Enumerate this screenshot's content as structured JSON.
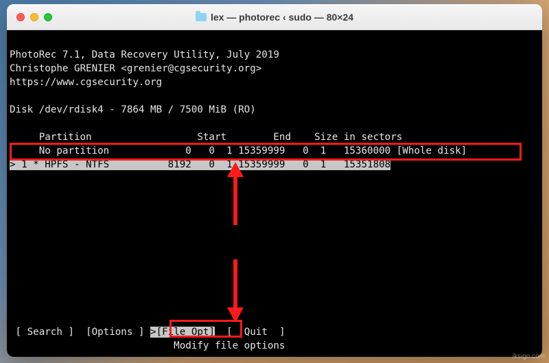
{
  "window": {
    "title": "lex — photorec ‹ sudo — 80×24"
  },
  "header": {
    "line1": "PhotoRec 7.1, Data Recovery Utility, July 2019",
    "line2": "Christophe GRENIER <grenier@cgsecurity.org>",
    "line3": "https://www.cgsecurity.org"
  },
  "disk_line": "Disk /dev/rdisk4 - 7864 MB / 7500 MiB (RO)",
  "table": {
    "header": "     Partition                  Start        End    Size in sectors",
    "row0": "     No partition             0   0  1 15359999   0  1   15360000 [Whole disk]",
    "row1": "> 1 * HPFS - NTFS          8192   0  1 15359999   0  1   15351808"
  },
  "menu": {
    "search": "[ Search ]",
    "options": "[Options ]",
    "fileopt_sel": ">[File Opt]",
    "quit": "[  Quit  ]",
    "caption": "                            Modify file options"
  },
  "watermark": "iksign.com"
}
